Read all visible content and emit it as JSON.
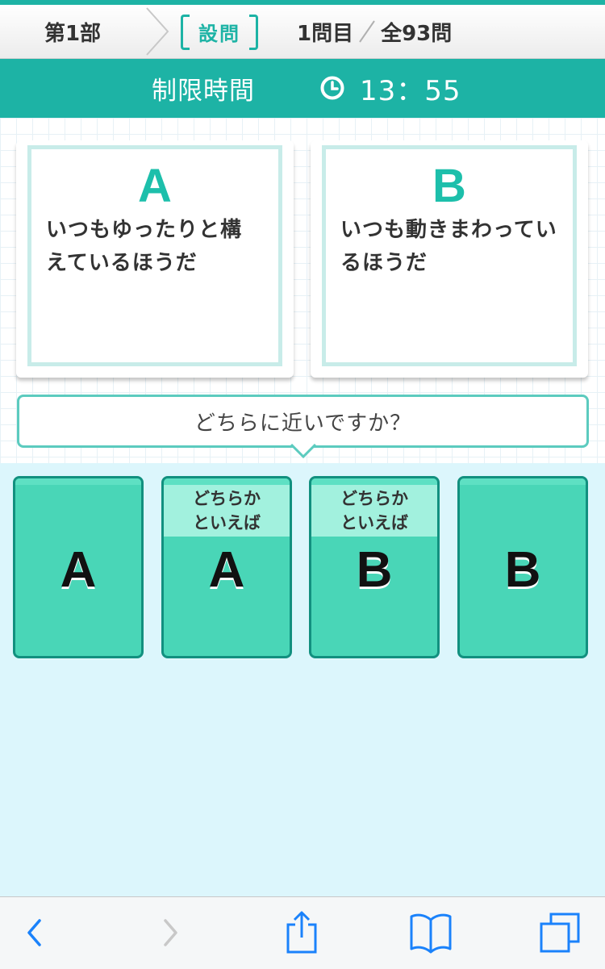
{
  "header": {
    "part_label": "第1部",
    "section_tag": "設問",
    "question_current": "1問目",
    "question_total": "全93問"
  },
  "timer": {
    "label": "制限時間",
    "icon": "clock-icon",
    "remaining": "13：55"
  },
  "question": {
    "option_a": {
      "letter": "A",
      "text": "いつもゆったりと構えているほうだ"
    },
    "option_b": {
      "letter": "B",
      "text": "いつも動きまわっているほうだ"
    },
    "prompt": "どちらに近いですか？"
  },
  "answers": [
    {
      "sub": "",
      "letter": "A"
    },
    {
      "sub": "どちらか\nといえば",
      "letter": "A"
    },
    {
      "sub": "どちらか\nといえば",
      "letter": "B"
    },
    {
      "sub": "",
      "letter": "B"
    }
  ],
  "toolbar": {
    "icons": [
      "back-icon",
      "forward-icon",
      "share-icon",
      "bookmarks-icon",
      "tabs-icon"
    ]
  },
  "colors": {
    "accent": "#1db3a5",
    "answer_fill": "#49d6b7",
    "answer_border": "#12907f",
    "answer_sub": "#a2f1de",
    "background": "#dcf6fc",
    "ios_blue": "#1a82fb"
  }
}
